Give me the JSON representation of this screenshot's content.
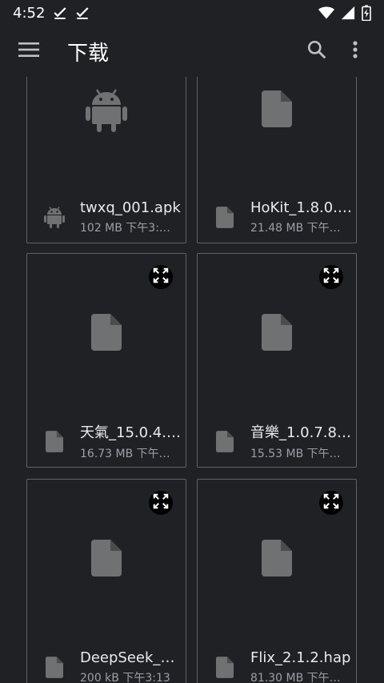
{
  "status_bar": {
    "time": "4:52"
  },
  "app_bar": {
    "title": "下载"
  },
  "files": [
    {
      "name": "twxq_001.apk",
      "detail": "102 MB 下午3:…",
      "type": "android"
    },
    {
      "name": "HoKit_1.8.0.…",
      "detail": "21.48 MB 下午…",
      "type": "document"
    },
    {
      "name": "天氣_15.0.4.…",
      "detail": "16.73 MB 下午…",
      "type": "document"
    },
    {
      "name": "音樂_1.0.7.8…",
      "detail": "15.53 MB 下午…",
      "type": "document"
    },
    {
      "name": "DeepSeek_1.…",
      "detail": "200 kB 下午3:13",
      "type": "document"
    },
    {
      "name": "Flix_2.1.2.hap",
      "detail": "81.30 MB 下午…",
      "type": "document"
    }
  ]
}
